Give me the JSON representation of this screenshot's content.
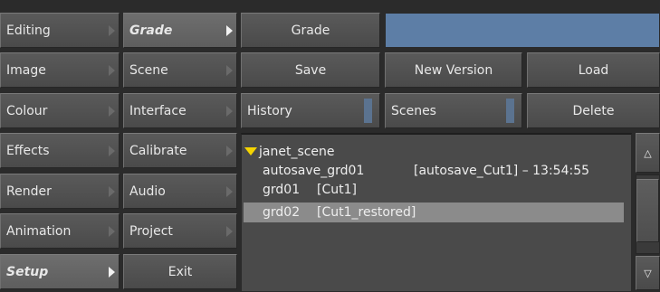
{
  "menu_col1": [
    {
      "label": "Editing"
    },
    {
      "label": "Image"
    },
    {
      "label": "Colour"
    },
    {
      "label": "Effects"
    },
    {
      "label": "Render"
    },
    {
      "label": "Animation"
    },
    {
      "label": "Setup"
    }
  ],
  "menu_col2": [
    {
      "label": "Grade"
    },
    {
      "label": "Scene"
    },
    {
      "label": "Interface"
    },
    {
      "label": "Calibrate"
    },
    {
      "label": "Audio"
    },
    {
      "label": "Project"
    },
    {
      "label": "Exit"
    }
  ],
  "toolbar": {
    "grade_label": "Grade",
    "save_label": "Save",
    "new_version_label": "New Version",
    "load_label": "Load",
    "history_label": "History",
    "scenes_label": "Scenes",
    "delete_label": "Delete",
    "name_value": ""
  },
  "list": {
    "scene_name": "janet_scene",
    "items": [
      {
        "name": "autosave_grd01",
        "detail": "[autosave_Cut1] – 13:54:55"
      },
      {
        "name": "grd01",
        "detail": "[Cut1]"
      },
      {
        "name": "grd02",
        "detail": "[Cut1_restored]"
      }
    ]
  },
  "scrollbar": {
    "up_glyph": "△",
    "down_glyph": "▽"
  },
  "colors": {
    "name_field": "#5d7ea6",
    "tab_indicator": "#5b7390",
    "scene_triangle": "#f5d400",
    "selected_row": "#8b8b8b"
  }
}
